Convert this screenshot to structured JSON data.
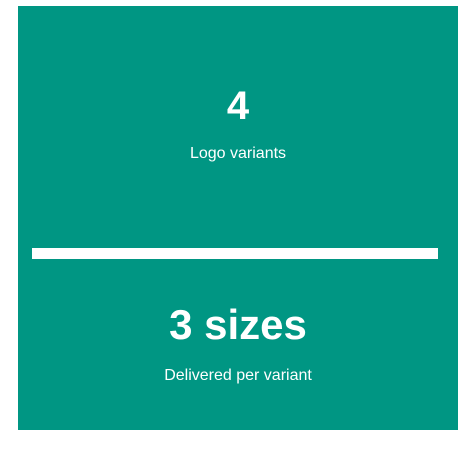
{
  "colors": {
    "panel_background": "#009683",
    "text": "#ffffff",
    "divider": "#ffffff"
  },
  "stats": [
    {
      "value": "4",
      "label": "Logo variants"
    },
    {
      "value": "3 sizes",
      "label": "Delivered per variant"
    }
  ]
}
